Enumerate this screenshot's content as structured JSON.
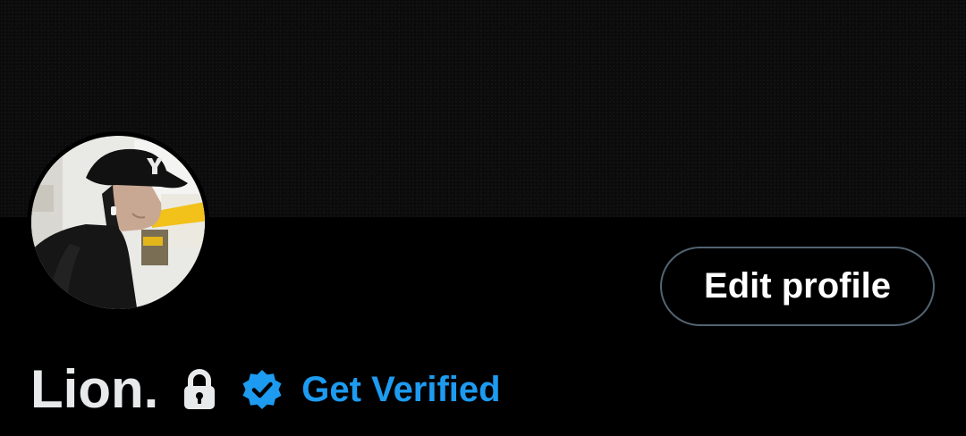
{
  "profile": {
    "display_name": "Lion.",
    "protected": true
  },
  "actions": {
    "edit_profile_label": "Edit profile",
    "get_verified_label": "Get Verified"
  },
  "icons": {
    "lock": "lock-icon",
    "verified": "verified-badge-icon"
  },
  "colors": {
    "background": "#000000",
    "banner": "#0b0b0c",
    "accent": "#1d9bf0",
    "text_primary": "#e7e9ea",
    "button_border": "#536471"
  }
}
